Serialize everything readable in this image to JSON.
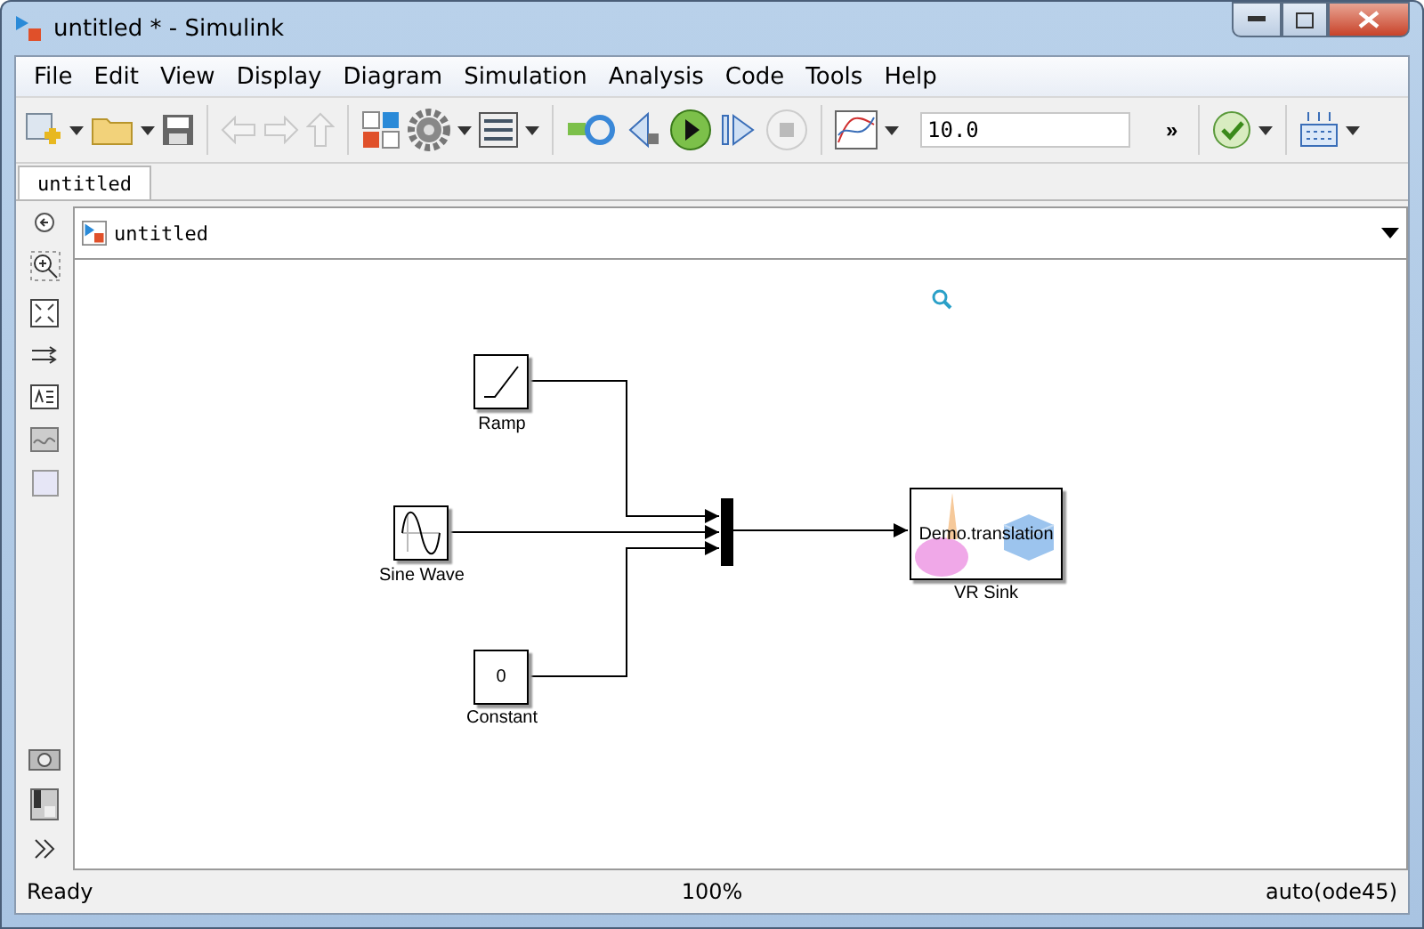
{
  "window": {
    "title": "untitled * - Simulink"
  },
  "menu": [
    "File",
    "Edit",
    "View",
    "Display",
    "Diagram",
    "Simulation",
    "Analysis",
    "Code",
    "Tools",
    "Help"
  ],
  "toolbar": {
    "stop_time": "10.0",
    "overflow": "»"
  },
  "tabs": [
    {
      "label": "untitled",
      "selected": true
    }
  ],
  "breadcrumb": {
    "path": "untitled"
  },
  "blocks": [
    {
      "kind": "ramp",
      "label": "Ramp"
    },
    {
      "kind": "sine",
      "label": "Sine Wave"
    },
    {
      "kind": "constant",
      "label": "Constant",
      "value": "0"
    },
    {
      "kind": "mux"
    },
    {
      "kind": "vrsink",
      "label": "VR Sink",
      "value": "Demo.translation"
    }
  ],
  "status_bar": {
    "state": "Ready",
    "zoom": "100%",
    "solver": "auto(ode45)"
  }
}
